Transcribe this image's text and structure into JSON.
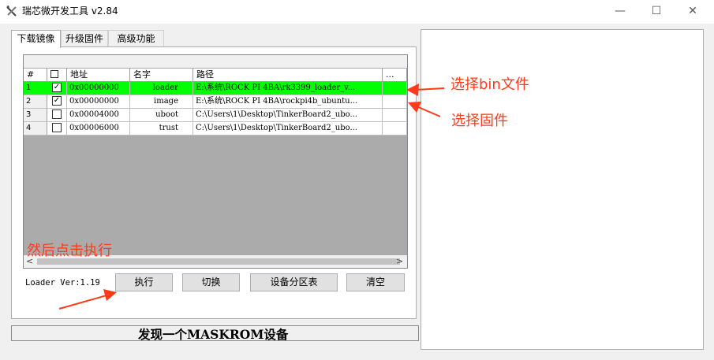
{
  "window": {
    "title": "瑞芯微开发工具 v2.84",
    "controls": {
      "minimize": "—",
      "maximize": "☐",
      "close": "✕"
    }
  },
  "tabs": [
    {
      "label": "下载镜像",
      "active": true
    },
    {
      "label": "升级固件",
      "active": false
    },
    {
      "label": "高级功能",
      "active": false
    }
  ],
  "grid": {
    "columns": [
      "#",
      "",
      "地址",
      "名字",
      "路径",
      "..."
    ],
    "rows": [
      {
        "num": "1",
        "checked": "✓",
        "address": "0x00000000",
        "name": "loader",
        "path": "E:\\系统\\ROCK PI 4BA\\rk3399_loader_v...",
        "extra": "",
        "selected": true
      },
      {
        "num": "2",
        "checked": "✓",
        "address": "0x00000000",
        "name": "image",
        "path": "E:\\系统\\ROCK PI 4BA\\rockpi4b_ubuntu...",
        "extra": "",
        "selected": false
      },
      {
        "num": "3",
        "checked": "",
        "address": "0x00004000",
        "name": "uboot",
        "path": "C:\\Users\\1\\Desktop\\TinkerBoard2_ubo...",
        "extra": "",
        "selected": false
      },
      {
        "num": "4",
        "checked": "",
        "address": "0x00006000",
        "name": "trust",
        "path": "C:\\Users\\1\\Desktop\\TinkerBoard2_ubo...",
        "extra": "",
        "selected": false
      }
    ],
    "scroll_left": "<",
    "scroll_right": ">"
  },
  "footer": {
    "loader_version": "Loader Ver:1.19",
    "buttons": {
      "execute": "执行",
      "switch": "切换",
      "partition_table": "设备分区表",
      "clear": "清空"
    }
  },
  "status": {
    "text": "发现一个MASKROM设备"
  },
  "annotations": {
    "select_bin": "选择bin文件",
    "select_firmware": "选择固件",
    "then_execute": "然后点击执行",
    "color": "#ff3a1a"
  },
  "colors": {
    "selected_row": "#00ff00",
    "button_face": "#e1e1e1",
    "window_bg": "#f0f0f0"
  }
}
